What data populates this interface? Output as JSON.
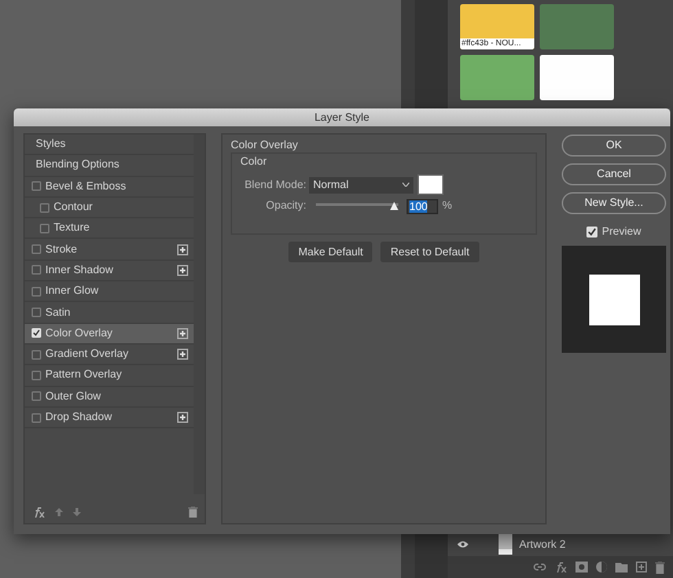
{
  "swatches": [
    {
      "color": "#f0c244",
      "label": "#ffc43b - NOU..."
    },
    {
      "color": "#527a52"
    },
    {
      "color": "#6fae64"
    },
    {
      "color": "#fefefe"
    }
  ],
  "layers": [
    {
      "name": "Artwork 2"
    }
  ],
  "dialog": {
    "title": "Layer Style",
    "styles": [
      {
        "label": "Styles",
        "kind": "header",
        "selected": false
      },
      {
        "label": "Blending Options",
        "kind": "header",
        "selected": false
      },
      {
        "label": "Bevel & Emboss",
        "kind": "effect",
        "checked": false,
        "selected": false,
        "addable": false,
        "children": [
          {
            "label": "Contour",
            "kind": "effect",
            "checked": false,
            "selected": false,
            "addable": false
          },
          {
            "label": "Texture",
            "kind": "effect",
            "checked": false,
            "selected": false,
            "addable": false
          }
        ]
      },
      {
        "label": "Stroke",
        "kind": "effect",
        "checked": false,
        "selected": false,
        "addable": true
      },
      {
        "label": "Inner Shadow",
        "kind": "effect",
        "checked": false,
        "selected": false,
        "addable": true
      },
      {
        "label": "Inner Glow",
        "kind": "effect",
        "checked": false,
        "selected": false,
        "addable": false
      },
      {
        "label": "Satin",
        "kind": "effect",
        "checked": false,
        "selected": false,
        "addable": false
      },
      {
        "label": "Color Overlay",
        "kind": "effect",
        "checked": true,
        "selected": true,
        "addable": true
      },
      {
        "label": "Gradient Overlay",
        "kind": "effect",
        "checked": false,
        "selected": false,
        "addable": true
      },
      {
        "label": "Pattern Overlay",
        "kind": "effect",
        "checked": false,
        "selected": false,
        "addable": false
      },
      {
        "label": "Outer Glow",
        "kind": "effect",
        "checked": false,
        "selected": false,
        "addable": false
      },
      {
        "label": "Drop Shadow",
        "kind": "effect",
        "checked": false,
        "selected": false,
        "addable": true
      }
    ],
    "panel": {
      "title": "Color Overlay",
      "group": "Color",
      "blend_label": "Blend Mode:",
      "blend_value": "Normal",
      "opacity_label": "Opacity:",
      "opacity": {
        "level": 1
      },
      "opacity_value": "100",
      "opacity_unit": "%",
      "buttons": [
        "Make Default",
        "Reset to Default"
      ]
    },
    "actions": [
      "OK",
      "Cancel",
      "New Style..."
    ],
    "preview": {
      "label": "Preview",
      "checked": true
    }
  }
}
